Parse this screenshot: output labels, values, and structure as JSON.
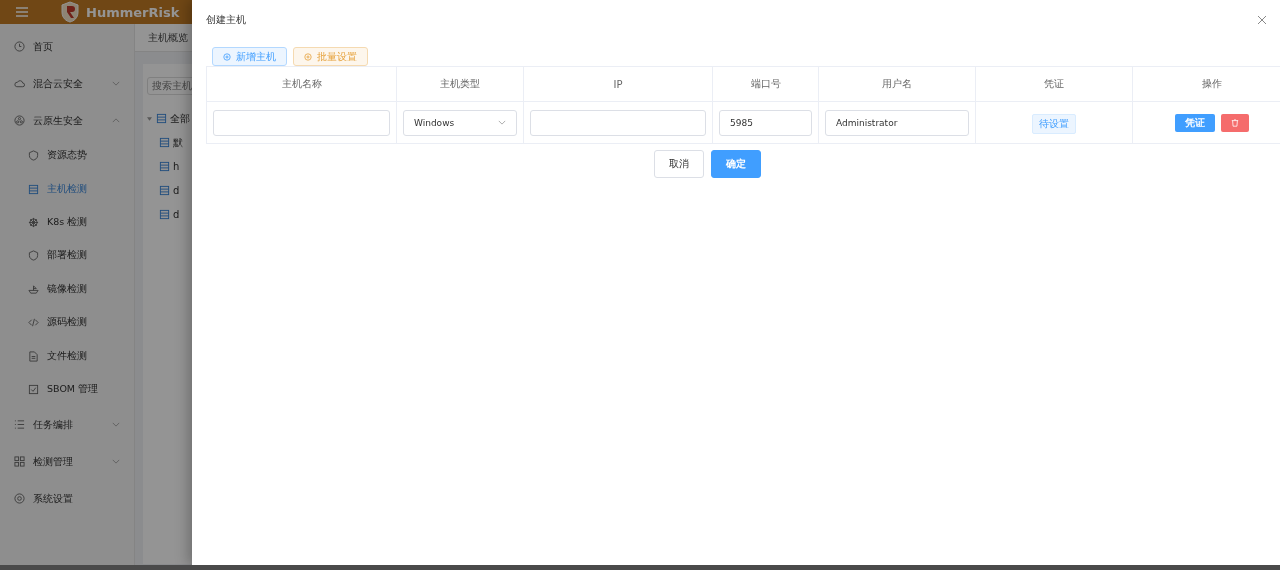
{
  "header": {
    "logo_text": "HummerRisk"
  },
  "sidebar": {
    "items": [
      {
        "label": "首页",
        "kind": "link"
      },
      {
        "label": "混合云安全",
        "kind": "group",
        "expanded": false
      },
      {
        "label": "云原生安全",
        "kind": "group",
        "expanded": true,
        "children": [
          {
            "label": "资源态势",
            "selected": false
          },
          {
            "label": "主机检测",
            "selected": true
          },
          {
            "label": "K8s 检测",
            "selected": false
          },
          {
            "label": "部署检测",
            "selected": false
          },
          {
            "label": "镜像检测",
            "selected": false
          },
          {
            "label": "源码检测",
            "selected": false
          },
          {
            "label": "文件检测",
            "selected": false
          },
          {
            "label": "SBOM 管理",
            "selected": false
          }
        ]
      },
      {
        "label": "任务编排",
        "kind": "group",
        "expanded": false
      },
      {
        "label": "检测管理",
        "kind": "group",
        "expanded": false
      },
      {
        "label": "系统设置",
        "kind": "link"
      }
    ]
  },
  "page": {
    "tab": "主机概览",
    "search": {
      "placeholder": "搜索主机"
    },
    "tree": {
      "label": "全部",
      "expanded": true,
      "children": [
        {
          "label": "默"
        },
        {
          "label": "h"
        },
        {
          "label": "d"
        },
        {
          "label": "d"
        }
      ]
    }
  },
  "drawer": {
    "title": "创建主机",
    "toolbar": [
      {
        "label": "新增主机",
        "kind": "primary"
      },
      {
        "label": "批量设置",
        "kind": "warning"
      }
    ],
    "table": {
      "columns": [
        "主机名称",
        "主机类型",
        "IP",
        "端口号",
        "用户名",
        "凭证",
        "操作"
      ],
      "rows": [
        {
          "name": "",
          "type": "Windows",
          "ip": "",
          "port": "5985",
          "username": "Administrator",
          "credential": "待设置",
          "actions": [
            {
              "label": "凭证",
              "kind": "primary"
            },
            {
              "kind": "delete"
            }
          ]
        }
      ]
    },
    "footer": [
      {
        "label": "取消",
        "kind": "default"
      },
      {
        "label": "确定",
        "kind": "primary"
      }
    ]
  }
}
